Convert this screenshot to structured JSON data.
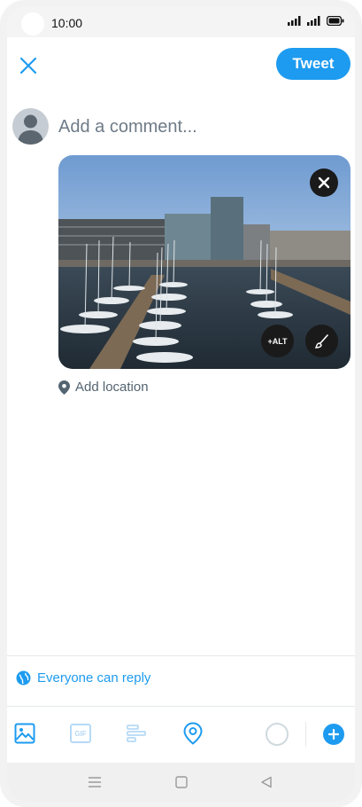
{
  "status_bar": {
    "time": "10:00"
  },
  "header": {
    "tweet_label": "Tweet"
  },
  "compose": {
    "placeholder": "Add a comment..."
  },
  "media": {
    "alt_label": "+ALT"
  },
  "location": {
    "label": "Add location"
  },
  "reply": {
    "label": "Everyone can reply"
  },
  "toolbar": {
    "icons": [
      "image-icon",
      "gif-icon",
      "poll-icon",
      "location-icon"
    ],
    "gif_label": "GIF"
  },
  "colors": {
    "accent": "#1d9bf0",
    "muted": "#536471"
  }
}
